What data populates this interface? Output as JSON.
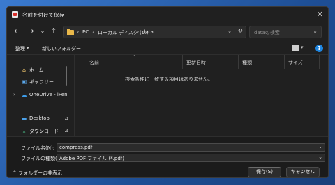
{
  "window": {
    "title": "名前を付けて保存",
    "close_glyph": "✕"
  },
  "nav": {
    "back": "←",
    "forward": "→",
    "dropdown": "⌄",
    "up": "↑",
    "crumbs": [
      "PC",
      "ローカル ディスク (C:)",
      "data"
    ],
    "crumb_sep": "›",
    "refresh": "↻",
    "search_placeholder": "dataの検索",
    "search_icon": "⌕"
  },
  "toolbar": {
    "organize": "整理",
    "organize_drop": "▾",
    "new_folder": "新しいフォルダー",
    "view_drop": "▾",
    "help": "?"
  },
  "sidebar": {
    "items": [
      {
        "label": "ホーム",
        "icon": "home-icon",
        "glyph": "⌂",
        "color": "#e8c06a"
      },
      {
        "label": "ギャラリー",
        "icon": "gallery-icon",
        "glyph": "▣",
        "color": "#5aa6e8"
      },
      {
        "label": "OneDrive - iPen",
        "icon": "cloud-icon",
        "glyph": "☁",
        "color": "#3c9be8",
        "arrow": "›"
      },
      {
        "label": "Desktop",
        "icon": "desktop-icon",
        "glyph": "▬",
        "color": "#4aa0e8",
        "pin": "⊿"
      },
      {
        "label": "ダウンロード",
        "icon": "download-icon",
        "glyph": "⤓",
        "color": "#4cc28a",
        "pin": "⊿"
      }
    ]
  },
  "columns": {
    "name": "名前",
    "modified": "更新日時",
    "type": "種類",
    "size": "サイズ",
    "sort_caret": "^"
  },
  "empty_message": "検索条件に一致する項目はありません。",
  "bottom": {
    "filename_label": "ファイル名(N):",
    "filename_value": "compress.pdf",
    "filetype_label": "ファイルの種類(T):",
    "filetype_value": "Adobe PDF ファイル (*.pdf)",
    "drop": "⌄",
    "hide_folders": "フォルダーの非表示",
    "hide_caret": "^",
    "save": "保存(S)",
    "cancel": "キャンセル"
  }
}
